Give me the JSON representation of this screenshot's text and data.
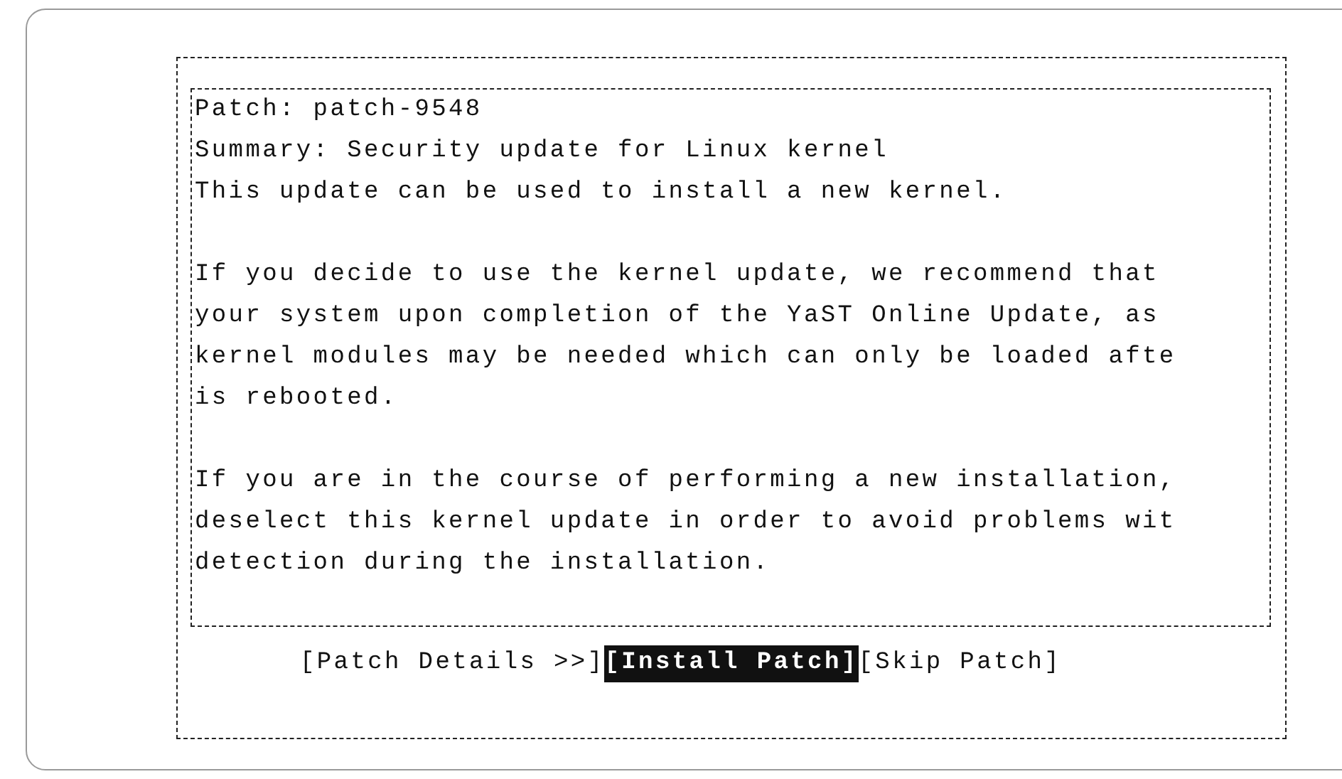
{
  "dialog": {
    "paragraphs": [
      {
        "lines": [
          "Patch: patch-9548",
          "Summary: Security update for Linux kernel",
          "This update can be used to install a new kernel."
        ]
      },
      {
        "lines": [
          "If you decide to use the kernel update, we recommend that",
          "your system upon completion of the YaST Online Update, as",
          "kernel modules may be needed which can only be loaded afte",
          "is rebooted."
        ]
      },
      {
        "lines": [
          "If you are in the course of performing a new installation,",
          "deselect this kernel update in order to avoid problems wit",
          "detection during the installation."
        ]
      }
    ],
    "buttons": [
      {
        "label": "[Patch Details >>]",
        "selected": false
      },
      {
        "label": "[Install Patch]",
        "selected": true
      },
      {
        "label": "[Skip Patch]",
        "selected": false
      }
    ]
  }
}
